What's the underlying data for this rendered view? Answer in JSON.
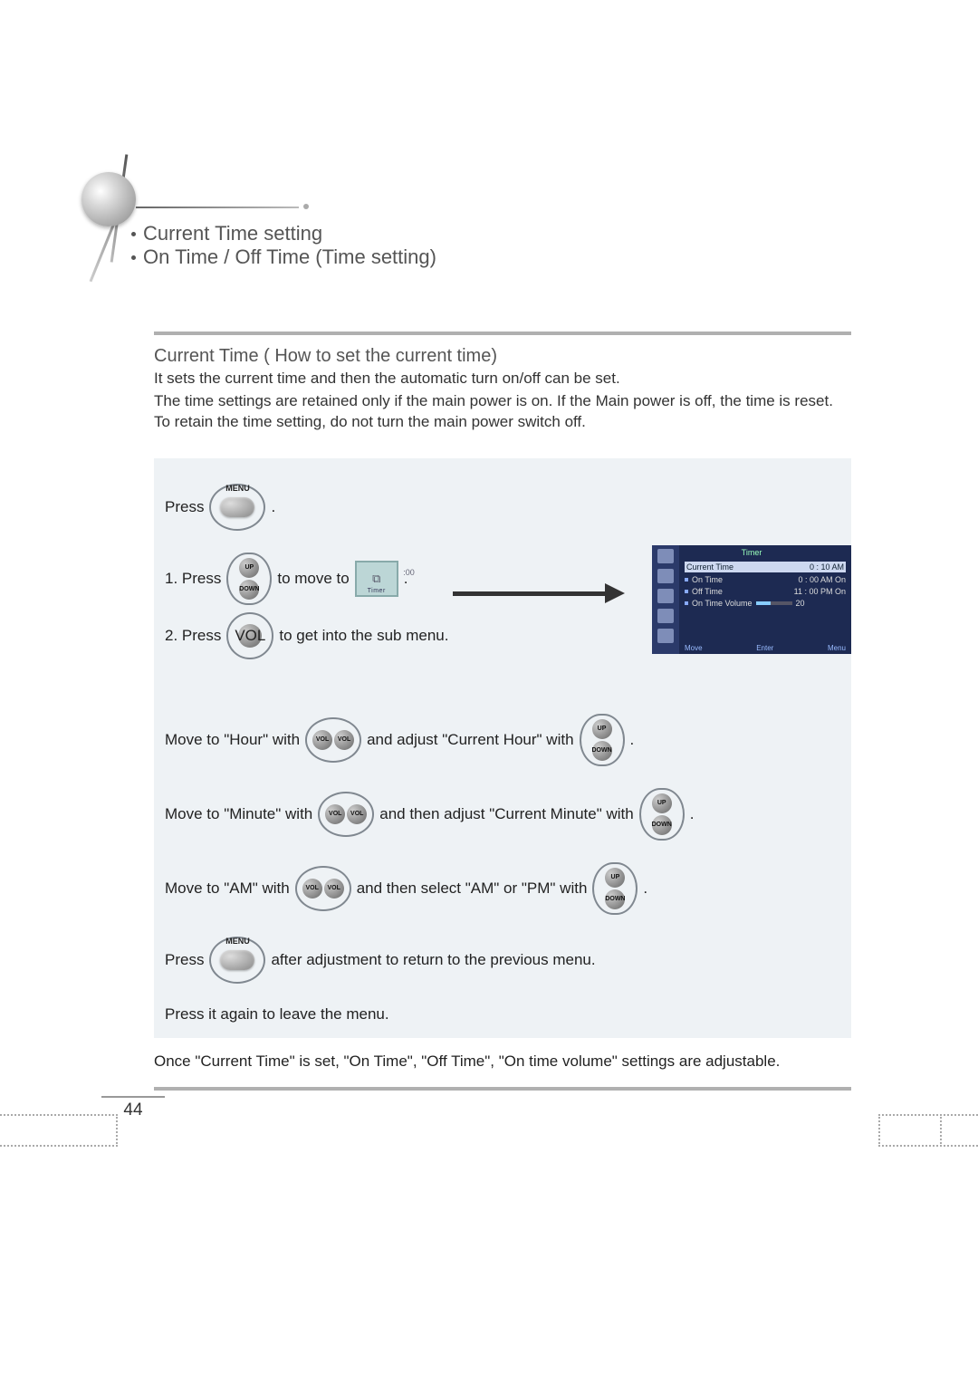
{
  "header": {
    "title1": "Current Time setting",
    "title2": "On Time / Off Time (Time setting)"
  },
  "section": {
    "heading": "Current Time ( How to set the current time)",
    "line1": "It sets the current time and then the automatic turn on/off can be set.",
    "line2": "The time settings are retained only if the main power is on. If the Main power is off, the time is reset. To retain the time setting, do not turn the main power switch off."
  },
  "steps": {
    "s0_a": "Press",
    "s0_c": ".",
    "s1_a": "1. Press",
    "s1_b": "to move to",
    "s1_d": ".",
    "s2_a": "2. Press",
    "s2_b": "to get into the sub menu.",
    "s3_a": "Move to \"Hour\" with",
    "s3_b": "and adjust \"Current Hour\" with",
    "s3_c": ".",
    "s4_a": "Move to \"Minute\" with",
    "s4_b": "and then adjust \"Current Minute\" with",
    "s4_c": ".",
    "s5_a": "Move to \"AM\" with",
    "s5_b": "and then select \"AM\" or \"PM\" with",
    "s5_c": ".",
    "s6_a": "Press",
    "s6_b": "after adjustment to return to the previous menu.",
    "s7": "Press it again to leave the menu.",
    "s8": "Once \"Current Time\" is set, \"On Time\", \"Off Time\", \"On time volume\" settings are adjustable."
  },
  "buttons": {
    "menu": "MENU",
    "vol_left": "VOL",
    "vol_right": "VOL",
    "up": "UP",
    "down": "DOWN"
  },
  "timer_chip": {
    "clock_glyph": "⧉",
    "side_text": ":00",
    "label": "Timer"
  },
  "osd": {
    "title": "Timer",
    "rows": [
      {
        "label": "Current Time",
        "value": "0 : 10   AM",
        "first": true
      },
      {
        "label": "On Time",
        "value": "0 : 00   AM   On"
      },
      {
        "label": "Off Time",
        "value": "11 : 00   PM   On"
      },
      {
        "label": "On Time Volume",
        "value": "20",
        "bar": true
      }
    ],
    "footer": {
      "move": "Move",
      "enter": "Enter",
      "menu": "Menu"
    }
  },
  "page_number": "44"
}
